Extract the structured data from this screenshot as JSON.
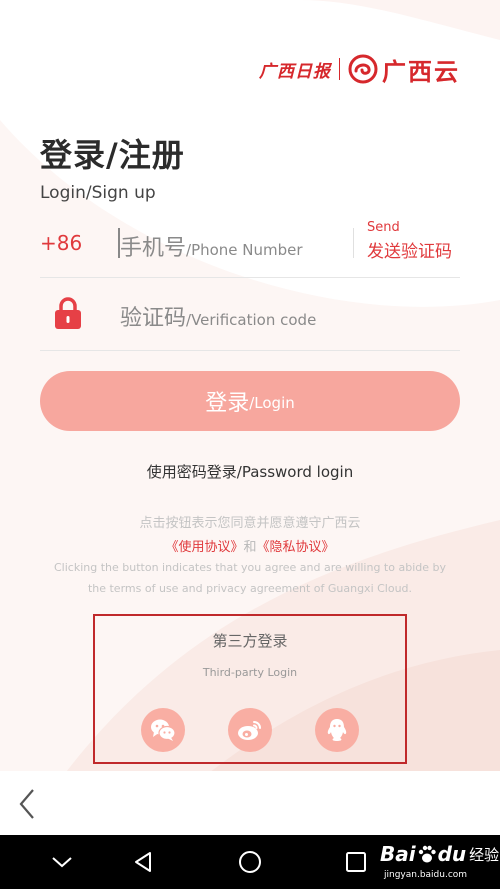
{
  "logo": {
    "newspaper": "广西日报",
    "brand": "广西云"
  },
  "header": {
    "title": "登录/注册",
    "subtitle": "Login/Sign up"
  },
  "phone": {
    "country_code": "+86",
    "placeholder_cn": "手机号",
    "placeholder_en": "/Phone Number",
    "value": ""
  },
  "send": {
    "label_en": "Send",
    "label_cn": "发送验证码"
  },
  "code": {
    "placeholder_cn": "验证码",
    "placeholder_en": "/Verification code",
    "value": ""
  },
  "login_button": {
    "label_cn": "登录",
    "label_en": "/Login"
  },
  "password_login": "使用密码登录/Password login",
  "agreement": {
    "line_cn": "点击按钮表示您同意并愿意遵守广西云",
    "terms_link": "《使用协议》",
    "and": "和",
    "privacy_link": "《隐私协议》",
    "line_en_1": "Clicking the button indicates that you agree and are willing to abide by",
    "line_en_2": "the terms of use and privacy agreement of Guangxi Cloud."
  },
  "third_party": {
    "title": "第三方登录",
    "subtitle": "Third-party Login",
    "icons": [
      "wechat-icon",
      "weibo-icon",
      "qq-icon"
    ]
  },
  "watermark": {
    "brand_a": "Bai",
    "brand_b": "du",
    "suffix": "经验",
    "url": "jingyan.baidu.com"
  },
  "colors": {
    "accent": "#e0393c",
    "login_button": "#f7a79e",
    "social_icon_bg": "#f9aea3",
    "highlight_border": "#c0292b"
  }
}
